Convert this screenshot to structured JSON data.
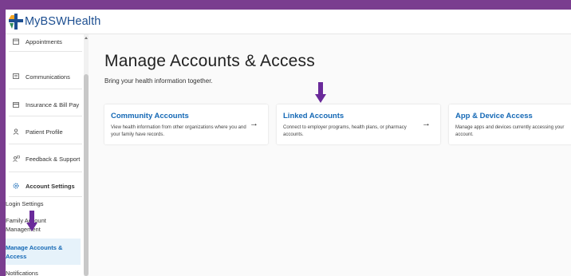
{
  "header": {
    "app_name": "MyBSWHealth"
  },
  "sidebar": {
    "items": [
      {
        "label": "Appointments",
        "icon": "calendar-icon"
      },
      {
        "label": "Communications",
        "icon": "message-icon"
      },
      {
        "label": "Insurance & Bill Pay",
        "icon": "credit-card-icon"
      },
      {
        "label": "Patient Profile",
        "icon": "person-icon"
      },
      {
        "label": "Feedback & Support",
        "icon": "feedback-icon"
      },
      {
        "label": "Account Settings",
        "icon": "gear-icon"
      }
    ],
    "sub_items": [
      {
        "label": "Login Settings"
      },
      {
        "label_line1": "Family Account",
        "label_line2": "Management"
      },
      {
        "label_line1": "Manage Accounts &",
        "label_line2": "Access"
      },
      {
        "label": "Notifications"
      }
    ]
  },
  "main": {
    "title": "Manage Accounts & Access",
    "subtitle": "Bring your health information together.",
    "cards": [
      {
        "title": "Community Accounts",
        "description": "View health information from other organizations where you and your family have records."
      },
      {
        "title": "Linked Accounts",
        "description": "Connect to employer programs, health plans, or pharmacy accounts."
      },
      {
        "title": "App & Device Access",
        "description": "Manage apps and devices currently accessing your account."
      }
    ]
  },
  "colors": {
    "frame": "#7a3d8f",
    "accent": "#1468b5",
    "marker": "#6a2a9a",
    "active_bg": "#e6f2fa"
  }
}
